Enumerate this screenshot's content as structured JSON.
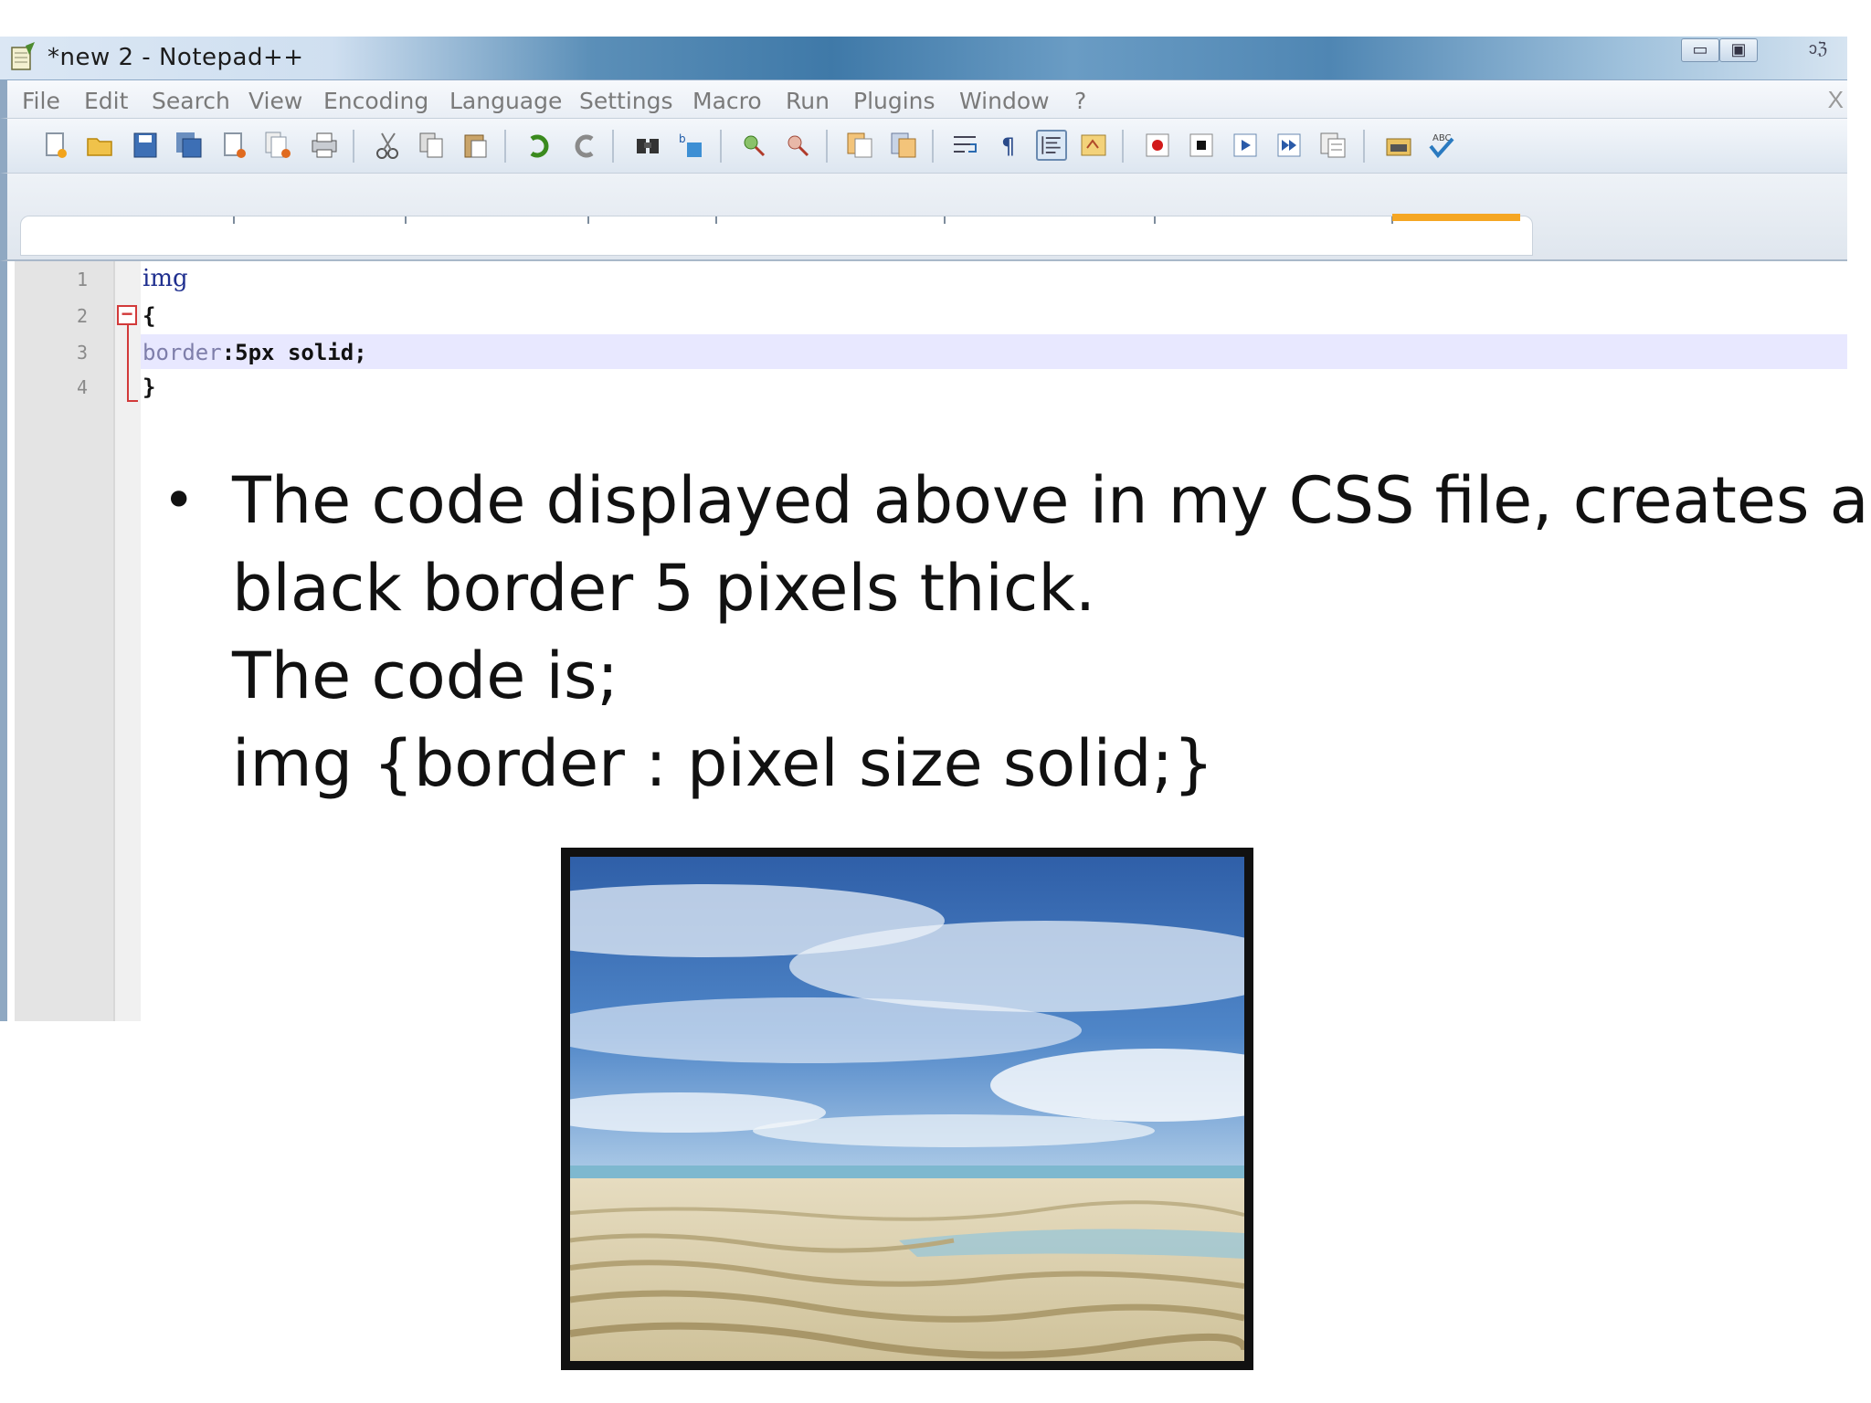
{
  "window": {
    "title": "*new  2 - Notepad++",
    "controls": {
      "minimize": "▭",
      "maximize": "▣",
      "close": "ↄℨ"
    }
  },
  "menu": {
    "items": [
      "File",
      "Edit",
      "Search",
      "View",
      "Encoding",
      "Language",
      "Settings",
      "Macro",
      "Run",
      "Plugins",
      "Window",
      "?"
    ],
    "close_doc": "X"
  },
  "toolbar": {
    "buttons": [
      "new-file-icon",
      "open-file-icon",
      "save-icon",
      "save-all-icon",
      "close-icon",
      "close-all-icon",
      "print-icon",
      "cut-icon",
      "copy-icon",
      "paste-icon",
      "undo-icon",
      "redo-icon",
      "find-icon",
      "replace-icon",
      "zoom-in-icon",
      "zoom-out-icon",
      "sync-vertical-icon",
      "sync-horizontal-icon",
      "word-wrap-icon",
      "show-all-chars-icon",
      "indent-guide-icon",
      "user-lang-icon",
      "record-macro-icon",
      "stop-record-icon",
      "play-macro-icon",
      "run-macro-multiple-icon",
      "save-macro-icon",
      "doc-map-icon",
      "spell-check-icon"
    ]
  },
  "editor": {
    "line_numbers": [
      "1",
      "2",
      "3",
      "4"
    ],
    "lines": {
      "l1": "img",
      "l2": "{",
      "l3_keyword": "border",
      "l3_rest": ":5px solid;",
      "l4": "}"
    },
    "fold_marker": "−"
  },
  "slide": {
    "bullet": "•",
    "lines": [
      "The code displayed above in my CSS file, creates a",
      "black border 5 pixels thick.",
      "The code is;",
      "img {border : pixel size solid;}"
    ]
  },
  "colors": {
    "accent_tab": "#f5a623",
    "fold_marker": "#d23a3a",
    "current_line": "#e8e8ff"
  }
}
